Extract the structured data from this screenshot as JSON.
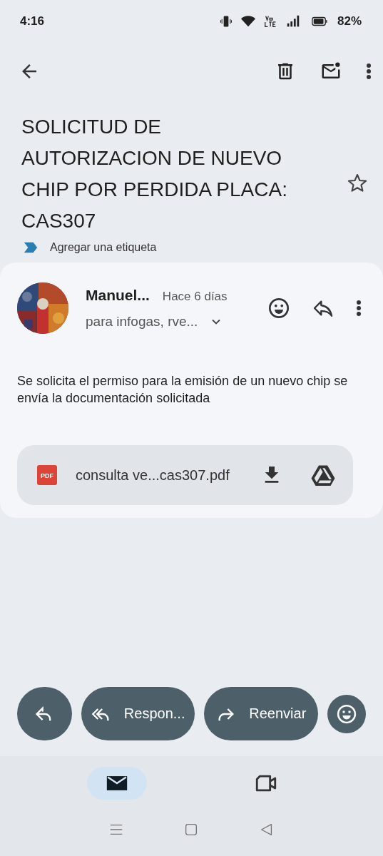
{
  "status_bar": {
    "time": "4:16",
    "battery": "82%"
  },
  "subject": {
    "text": "SOLICITUD DE AUTORIZACION DE NUEVO CHIP POR PERDIDA PLACA: CAS307",
    "label_action": "Agregar una etiqueta",
    "starred": false
  },
  "message": {
    "sender": "Manuel...",
    "time": "Hace 6 días",
    "recipients": "para infogas, rve...",
    "body": "Se solicita el permiso para la emisión de un nuevo chip se envía la documentación solicitada",
    "attachment": {
      "type": "PDF",
      "name": "consulta ve...cas307.pdf"
    }
  },
  "actions": [
    {
      "kind": "reply"
    },
    {
      "kind": "reply_all",
      "label": "Respon..."
    },
    {
      "kind": "forward",
      "label": "Reenviar"
    },
    {
      "kind": "emoji"
    }
  ],
  "bottom_nav": [
    {
      "kind": "mail",
      "selected": true
    },
    {
      "kind": "video",
      "selected": false
    }
  ]
}
